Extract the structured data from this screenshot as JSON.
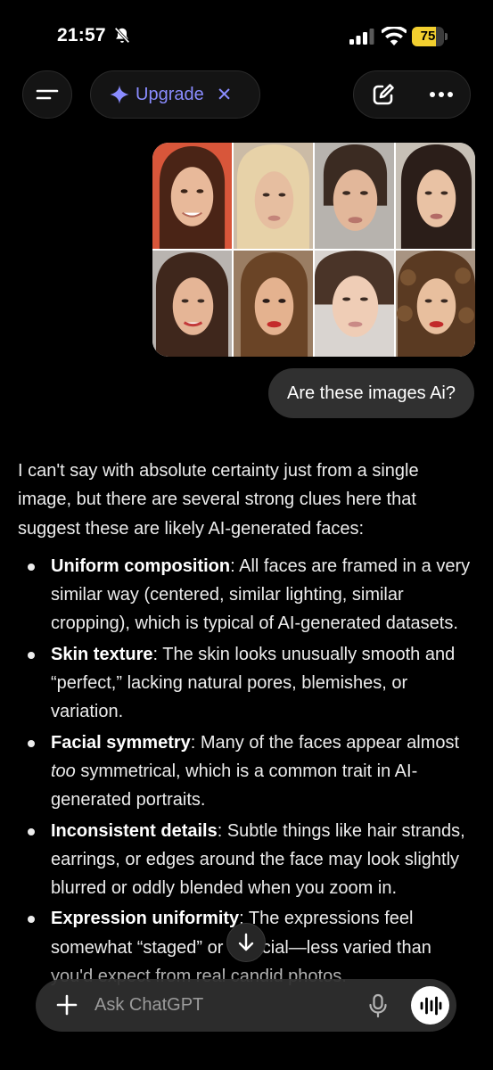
{
  "status_bar": {
    "time": "21:57",
    "battery_level": 75,
    "battery_text": "75",
    "battery_color": "#f2cf2f",
    "icons": [
      "bell-slash-icon",
      "signal-icon",
      "wifi-icon",
      "battery-icon"
    ]
  },
  "nav": {
    "menu_icon": "menu-icon",
    "upgrade_label": "Upgrade",
    "upgrade_icon": "sparkle-icon",
    "upgrade_close": "✕",
    "accent_color": "#8a8cff",
    "new_chat_icon": "edit-icon",
    "more_icon": "more-icon"
  },
  "chat": {
    "image_alt": "3",
    "user_message": "Are these images Ai?",
    "assistant": {
      "intro": "I can't say with absolute certainty just from a single image, but there are several strong clues here that suggest these are likely AI-generated faces:",
      "bullets": [
        {
          "title": "Uniform composition",
          "text": ": All faces are framed in a very similar way (centered, similar lighting, similar cropping), which is typical of AI-generated datasets."
        },
        {
          "title": "Skin texture",
          "text": ": The skin looks unusually smooth and “perfect,” lacking natural pores, blemishes, or variation."
        },
        {
          "title": "Facial symmetry",
          "text_before": ": Many of the faces appear almost ",
          "emphasis": "too",
          "text_after": " symmetrical, which is a common trait in AI-generated portraits."
        },
        {
          "title": "Inconsistent details",
          "text": ": Subtle things like hair strands, earrings, or edges around the face may look slightly blurred or oddly blended when you zoom in."
        },
        {
          "title": "Expression uniformity",
          "text": ": The expressions feel somewhat “staged” or artificial—less varied than you'd expect from real candid photos."
        }
      ]
    }
  },
  "composer": {
    "placeholder": "Ask ChatGPT",
    "plus_icon": "plus-icon",
    "mic_icon": "mic-icon",
    "voice_icon": "voice-mode-icon",
    "scroll_icon": "arrow-down-icon"
  }
}
